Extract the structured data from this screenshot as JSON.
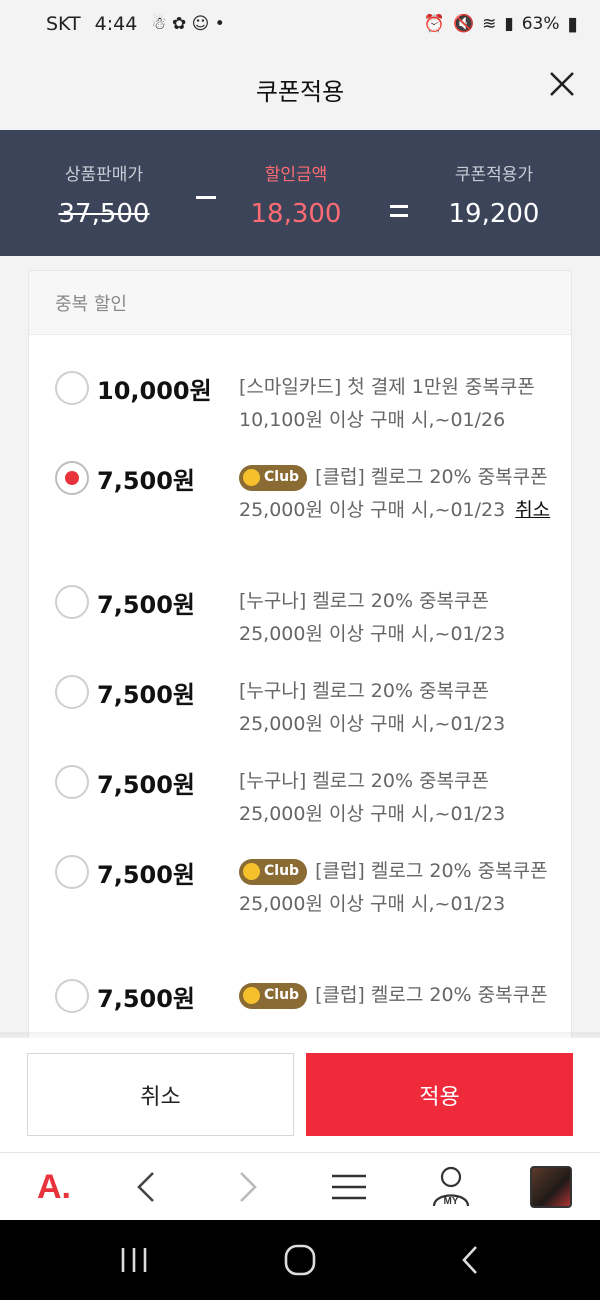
{
  "status_bar": {
    "carrier": "SKT",
    "time": "4:44",
    "battery": "63%"
  },
  "header": {
    "title": "쿠폰적용",
    "close_icon": "close-icon"
  },
  "summary": {
    "price_label": "상품판매가",
    "price_value": "37,500",
    "discount_label": "할인금액",
    "discount_value": "18,300",
    "final_label": "쿠폰적용가",
    "final_value": "19,200",
    "discount_color": "#ff6b73",
    "background": "#3b4459"
  },
  "section": {
    "title": "중복 할인"
  },
  "coupons": [
    {
      "amount": "10,000원",
      "selected": false,
      "badge": null,
      "name": "[스마일카드] 첫 결제 1만원 중복쿠폰",
      "condition": "10,100원 이상 구매 시,~01/26"
    },
    {
      "amount": "7,500원",
      "selected": true,
      "badge": "Club",
      "name": "[클럽] 켈로그 20% 중복쿠폰",
      "condition": "25,000원 이상 구매 시,~01/23",
      "cancel_label": "취소"
    },
    {
      "amount": "7,500원",
      "selected": false,
      "badge": null,
      "name": "[누구나] 켈로그 20% 중복쿠폰",
      "condition": "25,000원 이상 구매 시,~01/23"
    },
    {
      "amount": "7,500원",
      "selected": false,
      "badge": null,
      "name": "[누구나] 켈로그 20% 중복쿠폰",
      "condition": "25,000원 이상 구매 시,~01/23"
    },
    {
      "amount": "7,500원",
      "selected": false,
      "badge": null,
      "name": "[누구나] 켈로그 20% 중복쿠폰",
      "condition": "25,000원 이상 구매 시,~01/23"
    },
    {
      "amount": "7,500원",
      "selected": false,
      "badge": "Club",
      "name": "[클럽] 켈로그 20% 중복쿠폰",
      "condition": "25,000원 이상 구매 시,~01/23"
    },
    {
      "amount": "7,500원",
      "selected": false,
      "badge": "Club",
      "name": "[클럽] 켈로그 20% 중복쿠폰",
      "condition": ""
    }
  ],
  "actions": {
    "cancel_label": "취소",
    "apply_label": "적용",
    "apply_color": "#ee2a3b"
  },
  "bottom_nav": {
    "logo": "A.",
    "my_label": "MY",
    "items": [
      "logo-icon",
      "back-icon",
      "forward-icon",
      "menu-icon",
      "my-icon",
      "recent-product-thumbnail"
    ]
  },
  "system_nav": {
    "items": [
      "recent-apps-icon",
      "home-icon",
      "back-icon"
    ]
  }
}
